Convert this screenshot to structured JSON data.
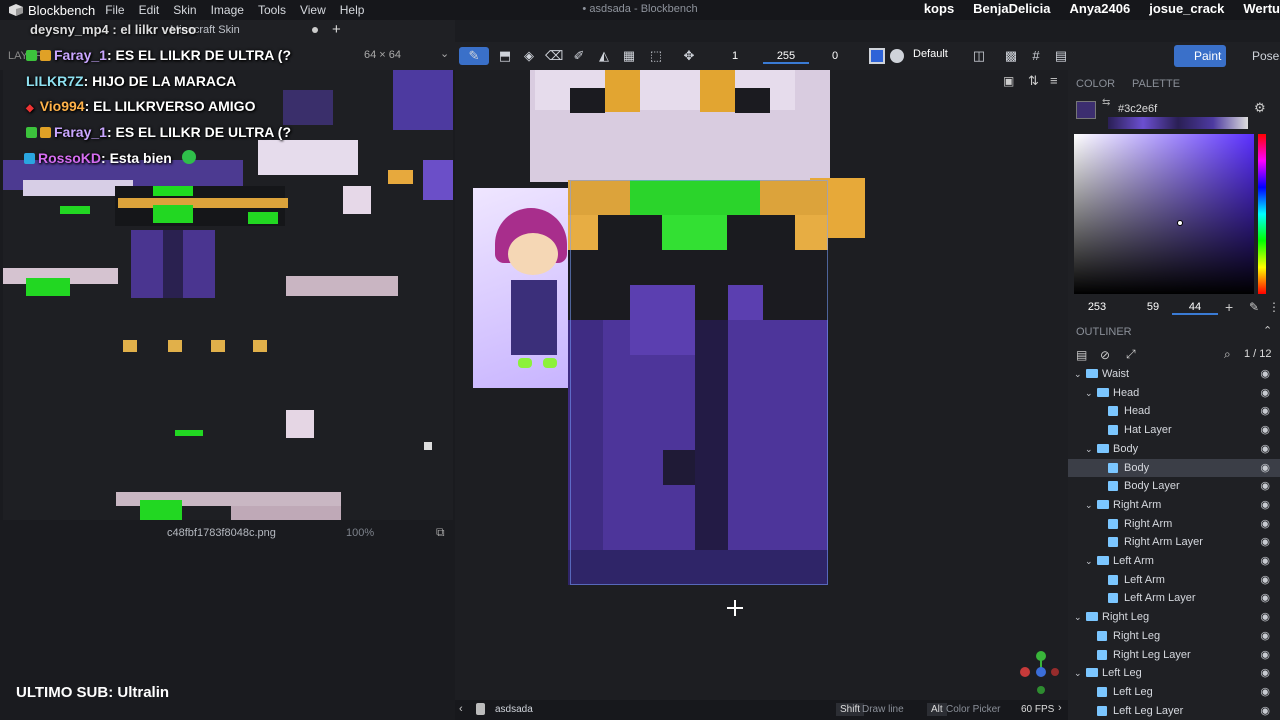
{
  "app": {
    "name": "Blockbench",
    "window_title": "• asdsada - Blockbench",
    "menus": [
      "File",
      "Edit",
      "Skin",
      "Image",
      "Tools",
      "View",
      "Help"
    ]
  },
  "stream_overlay": {
    "top_users": [
      "kops",
      "BenjaDelicia",
      "Anya2406",
      "josue_crack",
      "Wertu"
    ],
    "chat": [
      {
        "user": "Faray_1",
        "message": ": ES EL LILKR DE ULTRA (?"
      },
      {
        "user": "LILKR7Z",
        "message": ": HIJO DE LA MARACA"
      },
      {
        "user": "Vio994",
        "message": ": EL LILKRVERSO AMIGO"
      },
      {
        "user": "Faray_1",
        "message": ": ES EL LILKR DE ULTRA (?"
      },
      {
        "user": "RossoKD",
        "message": ": Esta bien"
      }
    ],
    "chat_partial_top": "deysny_mp4 : el lilkr verso",
    "last_sub": "ULTIMO SUB: Ultralin"
  },
  "tabs": {
    "active_tab": "Minecraft Skin",
    "add_label": "+"
  },
  "paint_panel": {
    "layers_label": "LAYERS",
    "resolution": "64 × 64",
    "filename": "c48fbf1783f8048c.png",
    "zoom": "100%"
  },
  "toolbar": {
    "brush_size": "1",
    "opacity": "255",
    "softness": "0",
    "blend_mode": "Default",
    "paint_label": "Paint",
    "pose_label": "Pose"
  },
  "color_panel": {
    "color_tab": "COLOR",
    "palette_tab": "PALETTE",
    "hex": "#3c2e6f",
    "r": "253",
    "g": "59",
    "b": "44",
    "current_color": "#3c2e6f"
  },
  "outliner": {
    "title": "OUTLINER",
    "count": "1 / 12",
    "items": [
      {
        "label": "Waist",
        "kind": "group",
        "depth": 0
      },
      {
        "label": "Head",
        "kind": "group",
        "depth": 1
      },
      {
        "label": "Head",
        "kind": "cube",
        "depth": 2
      },
      {
        "label": "Hat Layer",
        "kind": "cube",
        "depth": 2
      },
      {
        "label": "Body",
        "kind": "group",
        "depth": 1
      },
      {
        "label": "Body",
        "kind": "cube",
        "depth": 2,
        "selected": true
      },
      {
        "label": "Body Layer",
        "kind": "cube",
        "depth": 2
      },
      {
        "label": "Right Arm",
        "kind": "group",
        "depth": 1
      },
      {
        "label": "Right Arm",
        "kind": "cube",
        "depth": 2
      },
      {
        "label": "Right Arm Layer",
        "kind": "cube",
        "depth": 2
      },
      {
        "label": "Left Arm",
        "kind": "group",
        "depth": 1
      },
      {
        "label": "Left Arm",
        "kind": "cube",
        "depth": 2
      },
      {
        "label": "Left Arm Layer",
        "kind": "cube",
        "depth": 2
      },
      {
        "label": "Right Leg",
        "kind": "group",
        "depth": 0
      },
      {
        "label": "Right Leg",
        "kind": "cube",
        "depth": 1
      },
      {
        "label": "Right Leg Layer",
        "kind": "cube",
        "depth": 1
      },
      {
        "label": "Left Leg",
        "kind": "group",
        "depth": 0
      },
      {
        "label": "Left Leg",
        "kind": "cube",
        "depth": 1
      },
      {
        "label": "Left Leg Layer",
        "kind": "cube",
        "depth": 1
      }
    ]
  },
  "statusbar": {
    "project": "asdsada",
    "shift_key": "Shift",
    "shift_action": "Draw line",
    "alt_key": "Alt",
    "alt_action": "Color Picker",
    "fps": "60 FPS"
  },
  "icons": [
    "blockbench-logo",
    "brush-icon",
    "fill-icon",
    "eraser-icon",
    "eyedropper-icon",
    "selection-icon",
    "move-icon",
    "eye-icon",
    "search-icon",
    "settings-icon",
    "plus-icon",
    "cursor-crosshair-icon",
    "axis-gizmo-icon"
  ]
}
